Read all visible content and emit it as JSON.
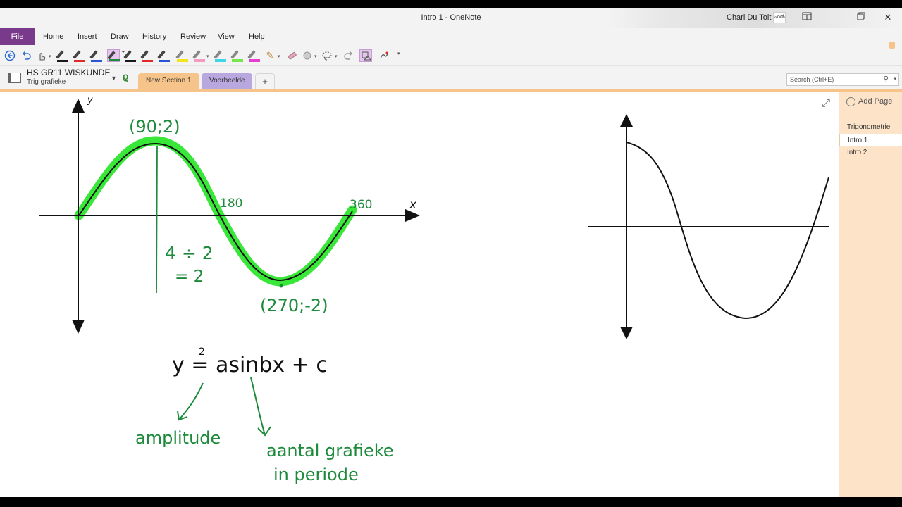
{
  "window": {
    "title": "Intro 1  -  OneNote",
    "user_name": "Charl Du Toit",
    "avatar_text": "ഫൻ",
    "controls": [
      "ribbon-display-icon",
      "minimize-icon",
      "restore-icon",
      "close-icon"
    ]
  },
  "menu": {
    "file": "File",
    "items": [
      "Home",
      "Insert",
      "Draw",
      "History",
      "Review",
      "View",
      "Help"
    ]
  },
  "toolbar": {
    "tools": [
      {
        "name": "back-icon"
      },
      {
        "name": "undo-icon"
      },
      {
        "name": "touch-drawing-icon"
      },
      {
        "name": "pen-black",
        "color": "#1a1a1a"
      },
      {
        "name": "pen-red",
        "color": "#e02a2a"
      },
      {
        "name": "pen-blue",
        "color": "#2a55d6"
      },
      {
        "name": "pen-green",
        "color": "#1f8a3a",
        "selected": true
      },
      {
        "name": "pen-black-2",
        "color": "#1a1a1a"
      },
      {
        "name": "pen-red-2",
        "color": "#e02a2a"
      },
      {
        "name": "pen-blue-2",
        "color": "#2a55d6"
      },
      {
        "name": "highlighter-yellow",
        "color": "#f5e31e"
      },
      {
        "name": "highlighter-pink",
        "color": "#f59ac0"
      },
      {
        "name": "highlighter-cyan",
        "color": "#3fd6e6"
      },
      {
        "name": "highlighter-green",
        "color": "#77e64a"
      },
      {
        "name": "highlighter-yellow-2",
        "color": "#f5e31e"
      },
      {
        "name": "highlighter-magenta",
        "color": "#e63fd0"
      },
      {
        "name": "pen-set-icon"
      },
      {
        "name": "eraser-icon"
      },
      {
        "name": "shape-icon"
      },
      {
        "name": "lasso-icon"
      },
      {
        "name": "redo-icon"
      },
      {
        "name": "ink-to-shape-icon"
      },
      {
        "name": "ink-to-math-icon"
      }
    ]
  },
  "notebook": {
    "name": "HS GR11 WISKUNDE",
    "section_group": "Trig grafieke",
    "sections": [
      "New Section 1",
      "Voorbeelde"
    ],
    "add_section_label": "+"
  },
  "search": {
    "placeholder": "Search (Ctrl+E)"
  },
  "pages": {
    "add_label": "Add Page",
    "items": [
      "Trigonometrie",
      "Intro 1",
      "Intro 2"
    ],
    "active": "Intro 1"
  },
  "ink": {
    "axis_x": "x",
    "axis_y": "y",
    "max_point": "(90;2)",
    "label_180": "180",
    "label_360": "360",
    "min_point": "(270;-2)",
    "calc_line1": "4 ÷ 2",
    "calc_line2": "= 2",
    "formula": "y = asinbx + c",
    "formula_sup": "2",
    "amplitude": "amplitude",
    "aantal_line1": "aantal grafieke",
    "aantal_line2": "in periode"
  },
  "colors": {
    "ribbon_purple": "#7a3a8c",
    "section_orange": "#f6c48a",
    "section_purple": "#b9a7e0",
    "ink_green": "#1e8a3c",
    "highlight_green": "#2ee62e",
    "page_pane": "#fde4c8"
  }
}
